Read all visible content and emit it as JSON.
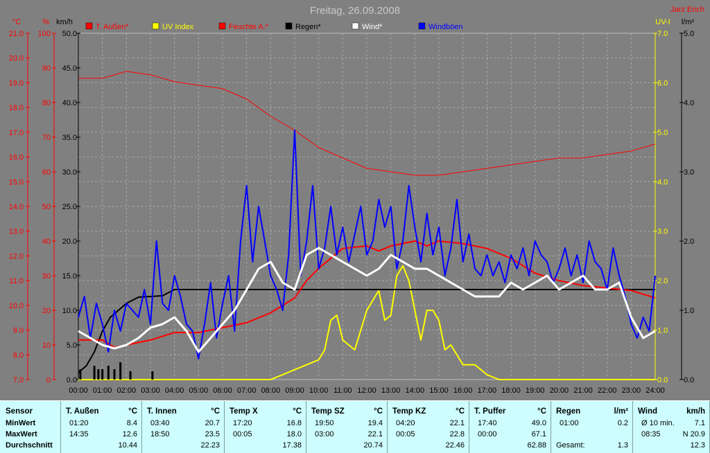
{
  "title": "Freitag, 26.09.2008",
  "author": "Jarz Erich",
  "colors": {
    "temp": "#ff0000",
    "uv": "#ffff00",
    "humidity": "#ff0000",
    "rain": "#000000",
    "wind": "#ffffff",
    "gusts": "#0000ff",
    "background": "#808080",
    "panel": "#cdfdfe"
  },
  "axes": {
    "temp_unit": "°C",
    "humidity_unit": "%",
    "wind_unit": "km/h",
    "uv_unit": "UV-I",
    "rain_unit": "l/m²",
    "temp_ticks": [
      "7.0",
      "8.0",
      "9.0",
      "10.0",
      "11.0",
      "12.0",
      "13.0",
      "14.0",
      "15.0",
      "16.0",
      "17.0",
      "18.0",
      "19.0",
      "20.0",
      "21.0"
    ],
    "humidity_ticks": [
      "0",
      "10",
      "20",
      "30",
      "40",
      "50",
      "60",
      "70",
      "80",
      "90",
      "100"
    ],
    "wind_ticks": [
      "0.0",
      "5.0",
      "10.0",
      "15.0",
      "20.0",
      "25.0",
      "30.0",
      "35.0",
      "40.0",
      "45.0",
      "50.0"
    ],
    "uv_ticks": [
      "0.0",
      "1.0",
      "2.0",
      "3.0",
      "4.0",
      "5.0",
      "6.0",
      "7.0"
    ],
    "rain_ticks": [
      "0.0",
      "1.0",
      "2.0",
      "3.0",
      "4.0",
      "5.0"
    ],
    "time_ticks": [
      "00:00",
      "01:00",
      "02:00",
      "03:00",
      "04:00",
      "05:00",
      "06:00",
      "07:00",
      "08:00",
      "09:00",
      "10:00",
      "11:00",
      "12:00",
      "13:00",
      "14:00",
      "15:00",
      "16:00",
      "17:00",
      "18:00",
      "19:00",
      "20:00",
      "21:00",
      "22:00",
      "23:00",
      "24:00"
    ]
  },
  "legend": [
    {
      "label": "T. Außen*",
      "color": "#ff0000"
    },
    {
      "label": "UV Index",
      "color": "#ffff00"
    },
    {
      "label": "Feuchte A.*",
      "color": "#ff0000"
    },
    {
      "label": "Regen*",
      "color": "#000000"
    },
    {
      "label": "Wind*",
      "color": "#ffffff"
    },
    {
      "label": "Windböen",
      "color": "#0000ff"
    }
  ],
  "chart_data": {
    "type": "line",
    "title": "Freitag, 26.09.2008",
    "x_label": "",
    "x_range": [
      "00:00",
      "24:00"
    ],
    "grid": true,
    "legend_position": "top",
    "series": [
      {
        "name": "T. Außen*",
        "axis": "temp",
        "unit": "°C",
        "ylim": [
          7,
          21
        ],
        "x": [
          "00:00",
          "01:00",
          "01:30",
          "02:00",
          "03:00",
          "04:00",
          "05:00",
          "06:00",
          "07:00",
          "08:00",
          "09:00",
          "09:30",
          "10:00",
          "11:00",
          "12:00",
          "12:30",
          "13:00",
          "14:00",
          "14:30",
          "15:00",
          "16:00",
          "17:00",
          "18:00",
          "19:00",
          "20:00",
          "21:00",
          "22:00",
          "23:00",
          "24:00"
        ],
        "values": [
          8.6,
          8.6,
          8.3,
          8.4,
          8.6,
          8.9,
          8.9,
          9.1,
          9.3,
          9.7,
          10.3,
          11.0,
          11.5,
          12.3,
          12.4,
          12.2,
          12.4,
          12.6,
          12.4,
          12.6,
          12.5,
          12.3,
          11.9,
          11.3,
          11.0,
          10.8,
          10.7,
          10.6,
          10.3
        ]
      },
      {
        "name": "UV Index",
        "axis": "uv",
        "unit": "UV-I",
        "ylim": [
          0,
          7
        ],
        "x": [
          "00:00",
          "08:00",
          "08:30",
          "09:00",
          "09:30",
          "10:00",
          "10:15",
          "10:30",
          "10:45",
          "11:00",
          "11:30",
          "12:00",
          "12:15",
          "12:30",
          "12:45",
          "13:00",
          "13:15",
          "13:30",
          "13:45",
          "14:00",
          "14:15",
          "14:30",
          "14:45",
          "15:00",
          "15:15",
          "15:30",
          "16:00",
          "16:30",
          "17:00",
          "17:30",
          "24:00"
        ],
        "values": [
          0,
          0,
          0.1,
          0.2,
          0.3,
          0.4,
          0.6,
          1.2,
          1.3,
          0.8,
          0.6,
          1.4,
          1.6,
          1.8,
          1.2,
          1.3,
          2.1,
          2.3,
          2.0,
          1.4,
          0.8,
          1.4,
          1.4,
          1.2,
          0.6,
          0.7,
          0.3,
          0.3,
          0.1,
          0,
          0
        ]
      },
      {
        "name": "Feuchte A.*",
        "axis": "humidity",
        "unit": "%",
        "ylim": [
          0,
          100
        ],
        "x": [
          "00:00",
          "01:00",
          "02:00",
          "03:00",
          "04:00",
          "05:00",
          "06:00",
          "07:00",
          "08:00",
          "09:00",
          "10:00",
          "11:00",
          "12:00",
          "13:00",
          "14:00",
          "15:00",
          "16:00",
          "17:00",
          "18:00",
          "19:00",
          "20:00",
          "21:00",
          "22:00",
          "23:00",
          "24:00"
        ],
        "values": [
          87,
          87,
          89,
          88,
          86,
          85,
          84,
          81,
          76,
          72,
          67,
          64,
          61,
          60,
          59,
          59,
          60,
          61,
          62,
          63,
          64,
          64,
          65,
          66,
          68
        ]
      },
      {
        "name": "Regen*",
        "axis": "rain",
        "unit": "l/m²",
        "ylim": [
          0,
          5
        ],
        "x": [
          "00:00",
          "00:20",
          "00:40",
          "01:00",
          "01:20",
          "01:40",
          "02:00",
          "02:30",
          "03:00",
          "03:30",
          "04:00",
          "04:30",
          "05:00",
          "08:00",
          "12:00",
          "16:00",
          "20:00",
          "24:00"
        ],
        "values": [
          0.1,
          0.2,
          0.4,
          0.7,
          0.9,
          1.0,
          1.1,
          1.19,
          1.2,
          1.21,
          1.3,
          1.3,
          1.3,
          1.3,
          1.3,
          1.3,
          1.3,
          1.3
        ]
      },
      {
        "name": "Wind*",
        "axis": "wind",
        "unit": "km/h",
        "ylim": [
          0,
          50
        ],
        "x": [
          "00:00",
          "00:30",
          "01:00",
          "01:30",
          "02:00",
          "02:30",
          "03:00",
          "03:30",
          "04:00",
          "04:30",
          "05:00",
          "05:30",
          "06:00",
          "06:30",
          "07:00",
          "07:30",
          "08:00",
          "08:30",
          "09:00",
          "09:30",
          "10:00",
          "10:30",
          "11:00",
          "11:30",
          "12:00",
          "12:30",
          "13:00",
          "13:30",
          "14:00",
          "14:30",
          "15:00",
          "15:30",
          "16:00",
          "16:30",
          "17:00",
          "17:30",
          "18:00",
          "18:30",
          "19:00",
          "19:30",
          "20:00",
          "20:30",
          "21:00",
          "21:30",
          "22:00",
          "22:30",
          "23:00",
          "23:30",
          "24:00"
        ],
        "values": [
          7,
          6,
          5,
          4.5,
          5,
          6,
          7.5,
          8,
          9,
          7,
          4,
          6,
          8,
          10,
          13,
          16,
          17,
          14,
          13,
          18,
          19,
          18,
          17,
          16,
          15,
          16,
          18,
          17,
          16,
          16,
          15,
          14,
          13,
          12,
          12,
          12,
          14,
          13,
          14,
          15,
          13,
          14,
          15,
          13,
          13,
          14,
          9,
          6,
          7
        ]
      },
      {
        "name": "Windböen",
        "axis": "wind",
        "unit": "km/h",
        "ylim": [
          0,
          50
        ],
        "x": [
          "00:00",
          "00:15",
          "00:30",
          "00:45",
          "01:00",
          "01:15",
          "01:30",
          "01:45",
          "02:00",
          "02:15",
          "02:30",
          "02:45",
          "03:00",
          "03:15",
          "03:30",
          "03:45",
          "04:00",
          "04:15",
          "04:30",
          "04:45",
          "05:00",
          "05:15",
          "05:30",
          "05:45",
          "06:00",
          "06:15",
          "06:30",
          "06:45",
          "07:00",
          "07:15",
          "07:30",
          "07:45",
          "08:00",
          "08:15",
          "08:30",
          "08:45",
          "09:00",
          "09:15",
          "09:30",
          "09:45",
          "10:00",
          "10:15",
          "10:30",
          "10:45",
          "11:00",
          "11:15",
          "11:30",
          "11:45",
          "12:00",
          "12:15",
          "12:30",
          "12:45",
          "13:00",
          "13:15",
          "13:30",
          "13:45",
          "14:00",
          "14:15",
          "14:30",
          "14:45",
          "15:00",
          "15:15",
          "15:30",
          "15:45",
          "16:00",
          "16:15",
          "16:30",
          "16:45",
          "17:00",
          "17:15",
          "17:30",
          "17:45",
          "18:00",
          "18:15",
          "18:30",
          "18:45",
          "19:00",
          "19:15",
          "19:30",
          "19:45",
          "20:00",
          "20:15",
          "20:30",
          "20:45",
          "21:00",
          "21:15",
          "21:30",
          "21:45",
          "22:00",
          "22:15",
          "22:30",
          "22:45",
          "23:00",
          "23:15",
          "23:30",
          "23:45",
          "24:00"
        ],
        "values": [
          9,
          12,
          6,
          11,
          8,
          4,
          10,
          7,
          11,
          10,
          9,
          13,
          8,
          20,
          11,
          10,
          15,
          12,
          8,
          7,
          3,
          8,
          14,
          6,
          11,
          15,
          7,
          20,
          28,
          17,
          25,
          20,
          15,
          13,
          10,
          18,
          36,
          15,
          20,
          28,
          16,
          19,
          25,
          18,
          22,
          17,
          21,
          25,
          18,
          20,
          26,
          22,
          25,
          16,
          20,
          28,
          22,
          17,
          24,
          18,
          22,
          15,
          19,
          26,
          17,
          21,
          16,
          15,
          18,
          15,
          17,
          14,
          18,
          16,
          19,
          15,
          20,
          18,
          17,
          14,
          16,
          19,
          15,
          18,
          14,
          20,
          17,
          16,
          13,
          19,
          15,
          12,
          8,
          6,
          9,
          7,
          15
        ]
      }
    ]
  },
  "stats": {
    "row_labels": {
      "header": "Sensor",
      "min": "MinWert",
      "max": "MaxWert",
      "avg": "Durchschnitt"
    },
    "columns": [
      {
        "name": "T. Außen",
        "unit": "°C",
        "min_time": "01:20",
        "min": "8.4",
        "max_time": "14:35",
        "max": "12.6",
        "avg": "10.44"
      },
      {
        "name": "T. Innen",
        "unit": "°C",
        "min_time": "03:40",
        "min": "20.7",
        "max_time": "18:50",
        "max": "23.5",
        "avg": "22.23"
      },
      {
        "name": "Temp X",
        "unit": "°C",
        "min_time": "17:20",
        "min": "16.8",
        "max_time": "00:05",
        "max": "18.0",
        "avg": "17.38"
      },
      {
        "name": "Temp SZ",
        "unit": "°C",
        "min_time": "19:50",
        "min": "19.4",
        "max_time": "03:00",
        "max": "22.1",
        "avg": "20.74"
      },
      {
        "name": "Temp KZ",
        "unit": "°C",
        "min_time": "04:20",
        "min": "22.1",
        "max_time": "00:05",
        "max": "22.8",
        "avg": "22.46"
      },
      {
        "name": "T. Puffer",
        "unit": "°C",
        "min_time": "17:40",
        "min": "49.0",
        "max_time": "00:00",
        "max": "67.1",
        "avg": "62.88"
      },
      {
        "name": "Regen",
        "unit": "l/m²",
        "min_time": "01:00",
        "min": "0.2",
        "max_time": "",
        "max": "",
        "avg_label": "Gesamt:",
        "avg": "1.3"
      },
      {
        "name": "Wind",
        "unit": "km/h",
        "min_time": "Ø 10 min.",
        "min": "7.1",
        "max_time": "08:35",
        "max": "N 20.9",
        "avg": "12.3"
      }
    ]
  }
}
